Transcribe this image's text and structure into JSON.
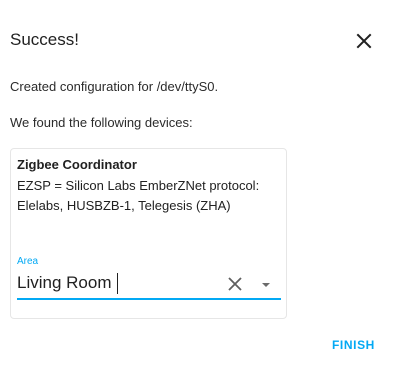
{
  "dialog": {
    "title": "Success!",
    "created_text": "Created configuration for /dev/ttyS0.",
    "found_text": "We found the following devices:"
  },
  "device": {
    "name": "Zigbee Coordinator",
    "description": "EZSP = Silicon Labs EmberZNet protocol: Elelabs, HUSBZB-1, Telegesis (ZHA)",
    "area_label": "Area",
    "area_value": "Living Room"
  },
  "actions": {
    "finish_label": "FINISH"
  },
  "icons": {
    "close": "close-icon",
    "clear": "clear-icon",
    "dropdown": "chevron-down-icon"
  },
  "colors": {
    "accent": "#03a9f4",
    "text": "#212121"
  }
}
